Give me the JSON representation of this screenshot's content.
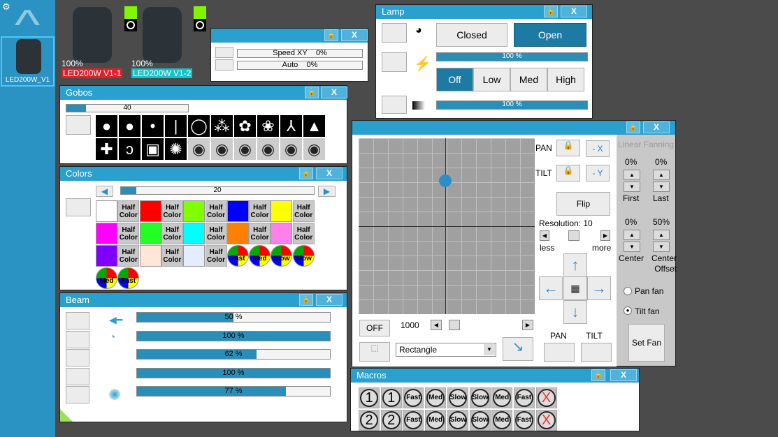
{
  "sidebar": {
    "fixture_label": "LED200W_V1"
  },
  "fixtures": [
    {
      "name": "LED200W V1-1",
      "intensity": "100%",
      "label_color": "#e0202a"
    },
    {
      "name": "LED200W V1-2",
      "intensity": "100%",
      "label_color": "#17c2c8"
    }
  ],
  "speed": {
    "rows": [
      {
        "label": "Speed XY",
        "value": "0%"
      },
      {
        "label": "Auto",
        "value": "0%"
      }
    ]
  },
  "lamp": {
    "title": "Lamp",
    "closed": "Closed",
    "open": "Open",
    "bar1": "100 %",
    "bar1_value": 100,
    "levels": [
      "Off",
      "Low",
      "Med",
      "High"
    ],
    "bar2": "100 %",
    "bar2_value": 100
  },
  "gobos": {
    "title": "Gobos",
    "slider": "40",
    "slider_value": 40
  },
  "colors": {
    "title": "Colors",
    "slider": "20",
    "slider_value": 20,
    "half": "Half Color",
    "grid": [
      [
        "#ffffff",
        "half",
        "#ff0000",
        "half",
        "#80ff00",
        "half",
        "#0000ff",
        "half",
        "#ffff00",
        "half"
      ],
      [
        "#ff00ff",
        "half",
        "#22ff22",
        "half",
        "#00ffff",
        "half",
        "#ff7f00",
        "half",
        "#ff80e8",
        "half"
      ],
      [
        "#8000ff",
        "half",
        "#ffe6d6",
        "half",
        "#e4ecff",
        "half",
        "Fast",
        "Med",
        "Slow",
        "Slow"
      ],
      [
        "Med",
        "Fast"
      ]
    ]
  },
  "beam": {
    "title": "Beam",
    "bars": [
      {
        "label": "50 %",
        "value": 50
      },
      {
        "label": "100 %",
        "value": 100
      },
      {
        "label": "62 %",
        "value": 62
      },
      {
        "label": "100 %",
        "value": 100
      },
      {
        "label": "77 %",
        "value": 77
      }
    ]
  },
  "pantilt": {
    "pan": "PAN",
    "tilt": "TILT",
    "neg_x": "- X",
    "neg_y": "- Y",
    "flip": "Flip",
    "resolution": "Resolution: 10",
    "less": "less",
    "more": "more",
    "off": "OFF",
    "speed": "1000",
    "shape": "Rectangle",
    "pan_btn": "PAN",
    "tilt_btn": "TILT",
    "fanning": {
      "title": "Linear Fanning",
      "first_val": "0%",
      "last_val": "0%",
      "first": "First",
      "last": "Last",
      "center_val": "0%",
      "offset_val": "50%",
      "center": "Center",
      "offset": "Center Offset",
      "pan_fan": "Pan fan",
      "tilt_fan": "Tilt fan",
      "set_fan": "Set Fan"
    }
  },
  "macros": {
    "title": "Macros",
    "rows": [
      [
        "1",
        "1",
        "Fast",
        "Med",
        "Slow",
        "Slow",
        "Med",
        "Fast",
        "X"
      ],
      [
        "2",
        "2",
        "Fast",
        "Med",
        "Slow",
        "Slow",
        "Med",
        "Fast",
        "X"
      ]
    ]
  }
}
